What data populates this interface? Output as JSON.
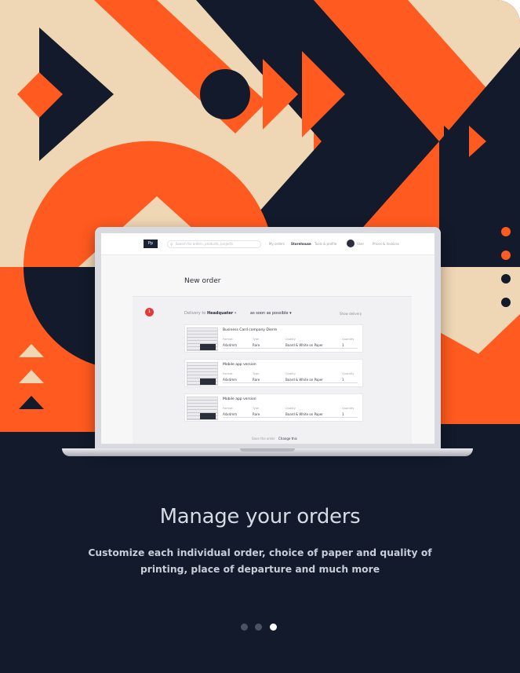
{
  "colors": {
    "navy": "#121a2b",
    "orange": "#ff5a1f",
    "beige": "#efd6b4",
    "white": "#ffffff"
  },
  "laptop": {
    "app": {
      "logo": "Pp",
      "search_placeholder": "Search for orders, products, projects",
      "nav": [
        "My orders",
        "Storehouse",
        "Tools & profile",
        "User",
        "Prices & Invoices"
      ],
      "page_title": "New order",
      "step_number": "1",
      "delivery_label": "Delivery to",
      "delivery_place": "Headquater",
      "delivery_time": "as soon as possible",
      "delivery_more": "Show delivery",
      "items": [
        {
          "name": "Business Card company Dierre",
          "fields": [
            "Format",
            "Type",
            "Quality",
            "Quantity"
          ],
          "values": [
            "A4x4mm",
            "Rare",
            "Board & White on Paper",
            "1"
          ]
        },
        {
          "name": "Mobile app version",
          "fields": [
            "Format",
            "Type",
            "Quality",
            "Quantity"
          ],
          "values": [
            "A4x4mm",
            "Rare",
            "Board & White on Paper",
            "1"
          ]
        },
        {
          "name": "Mobile app version",
          "fields": [
            "Format",
            "Type",
            "Quality",
            "Quantity"
          ],
          "values": [
            "A4x4mm",
            "Rare",
            "Board & White on Paper",
            "1"
          ]
        }
      ],
      "footer": [
        "Save the order",
        "Change this"
      ]
    }
  },
  "headline": "Manage your orders",
  "subtext": "Customize each individual order, choice of paper and quality of printing, place of departure and much more",
  "pager": {
    "count": 3,
    "active_index": 2
  }
}
